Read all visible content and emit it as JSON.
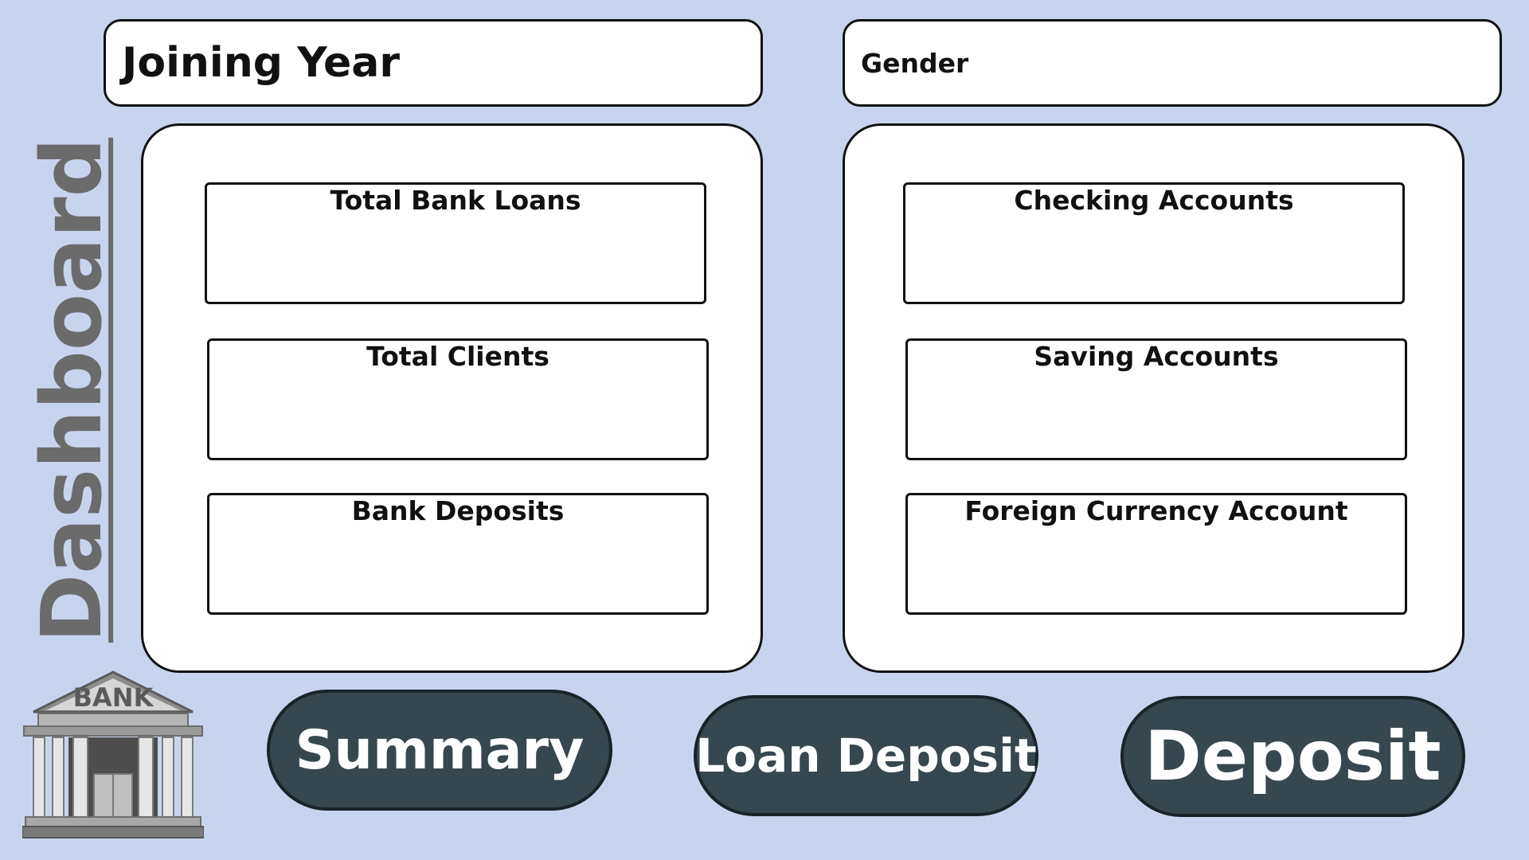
{
  "title": "Dashboard",
  "slicers": {
    "joining_year": "Joining Year",
    "gender": "Gender"
  },
  "left_panel": {
    "cards": [
      {
        "label": "Total Bank Loans",
        "value": ""
      },
      {
        "label": "Total Clients",
        "value": ""
      },
      {
        "label": "Bank Deposits",
        "value": ""
      }
    ]
  },
  "right_panel": {
    "cards": [
      {
        "label": "Checking Accounts",
        "value": ""
      },
      {
        "label": "Saving Accounts",
        "value": ""
      },
      {
        "label": "Foreign Currency Account",
        "value": ""
      }
    ]
  },
  "nav": {
    "summary": "Summary",
    "loan_deposit": "Loan Deposit",
    "deposit": "Deposit"
  },
  "logo": {
    "text": "BANK",
    "icon": "bank-building-icon"
  },
  "colors": {
    "background": "#c8d4ee",
    "button": "#37474f",
    "title": "#6b6b6b"
  }
}
